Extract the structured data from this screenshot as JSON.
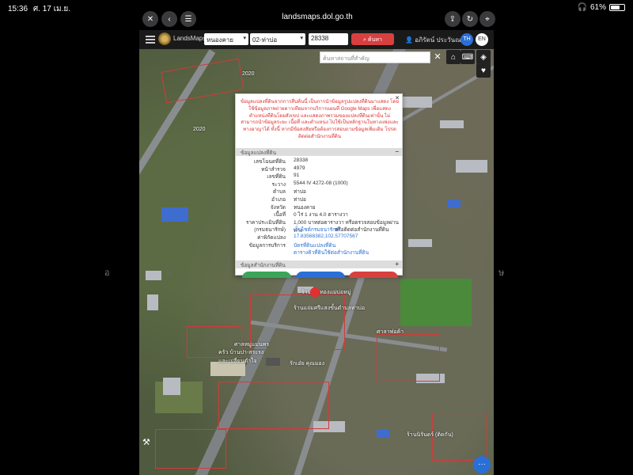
{
  "status_bar": {
    "time": "15:36",
    "date": "ศ. 17 เม.ย.",
    "battery": "61%",
    "battery_level": 0.61
  },
  "browser": {
    "url": "landsmaps.dol.go.th"
  },
  "toolbar": {
    "brand": "LandsMaps",
    "province": "หนองคาย",
    "district": "02-ท่าบ่อ",
    "parcel_no": "28338",
    "search_label": "ค้นหา",
    "user": "อภิรัตน์ ประวันณ",
    "lang_th": "TH",
    "lang_en": "EN"
  },
  "map": {
    "address_search_placeholder": "ค้นหาสถานที่สำคัญ",
    "road_labels": [
      "2020",
      "2020"
    ],
    "place_labels": [
      "ร้านแจ่มศรีแสงขั้นตำบลท่าบ่อ",
      "ร้านเงินทองแม่บ่อหมู่",
      "ศาลหมู่แม่นพร",
      "ครัว บ้านปา-สระรง และเปลี่ยนตำใจ",
      "รักเอ๋ย คุณมอง",
      "ศาลาพ่อค้า",
      "ร้านนิรันดร์ (ติดกัน)"
    ]
  },
  "popup": {
    "notice": "ข้อมูลแปลงที่ดินจากการสืบค้นนี้ เป็นการนำข้อมูลรูปแปลงที่ดินมาแสดง โดยใช้ข้อมูลภาพถ่ายดาวเทียมจากบริการแผนที่ Google Maps เพื่อแสดงตำแหน่งที่ดินโดยสังเขป และแสดงภาพรวมของแปลงที่ดินเท่านั้น ไม่สามารถนำข้อมูลระยะ เนื้อที่ และตำแหน่ง ไปใช้เป็นหลักฐานในทางแพ่งและทางอาญาได้ ทั้งนี้ หากมีข้อสงสัยหรือต้องการสอบถามข้อมูลเพิ่มเติม โปรดติดต่อสำนักงานที่ดิน",
    "section_parcel": "ข้อมูลแปลงที่ดิน",
    "section_office": "ข้อมูลสำนักงานที่ดิน",
    "fields": [
      {
        "key": "เลขโฉนดที่ดิน",
        "value": "28338"
      },
      {
        "key": "หน้าสำรวจ",
        "value": "4979"
      },
      {
        "key": "เลขที่ดิน",
        "value": "91"
      },
      {
        "key": "ระวาง",
        "value": "5544 IV 4272-08 (1000)"
      },
      {
        "key": "ตำบล",
        "value": "ท่าบ่อ"
      },
      {
        "key": "อำเภอ",
        "value": "ท่าบ่อ"
      },
      {
        "key": "จังหวัด",
        "value": "หนองคาย"
      },
      {
        "key": "เนื้อที่",
        "value": "0 ไร่ 1 งาน 4.0 ตารางวา"
      },
      {
        "key": "ราคาประเมินที่ดิน",
        "value": "1,000 บาทต่อตารางวา หรือตรวจสอบข้อมูลผ่านทาง"
      },
      {
        "key": "(กรมธนารักษ์)",
        "value": "เว็บไซต์กรมธนารักษ์",
        "value_suffix": " หรือติดต่อสำนักงานที่ดิน"
      },
      {
        "key": "ค่าพิกัดแปลง",
        "value": "17.83568382,102.57707567"
      },
      {
        "key": "ข้อมูลการบริการ",
        "value": "บัตรที่ดินแปลงที่ดิน",
        "value2": "ตารางคิวที่ดินใช้ต่อสำนักงานที่ดิน"
      }
    ]
  },
  "side_chars": {
    "left": "อ",
    "left2": "ย",
    "right": "ษ"
  },
  "colors": {
    "accent": "#d84040",
    "link": "#2a6fd6",
    "notice": "#e03030",
    "lang_active": "#2a6fd6"
  },
  "icons": [
    "close-icon",
    "back-icon",
    "tabs-icon",
    "share-icon",
    "reload-icon",
    "compass-icon",
    "menu-icon",
    "search-icon",
    "user-icon",
    "home-icon",
    "keyboard-icon",
    "layers-icon",
    "heart-icon",
    "pin-icon",
    "tool-icon",
    "chat-icon"
  ]
}
